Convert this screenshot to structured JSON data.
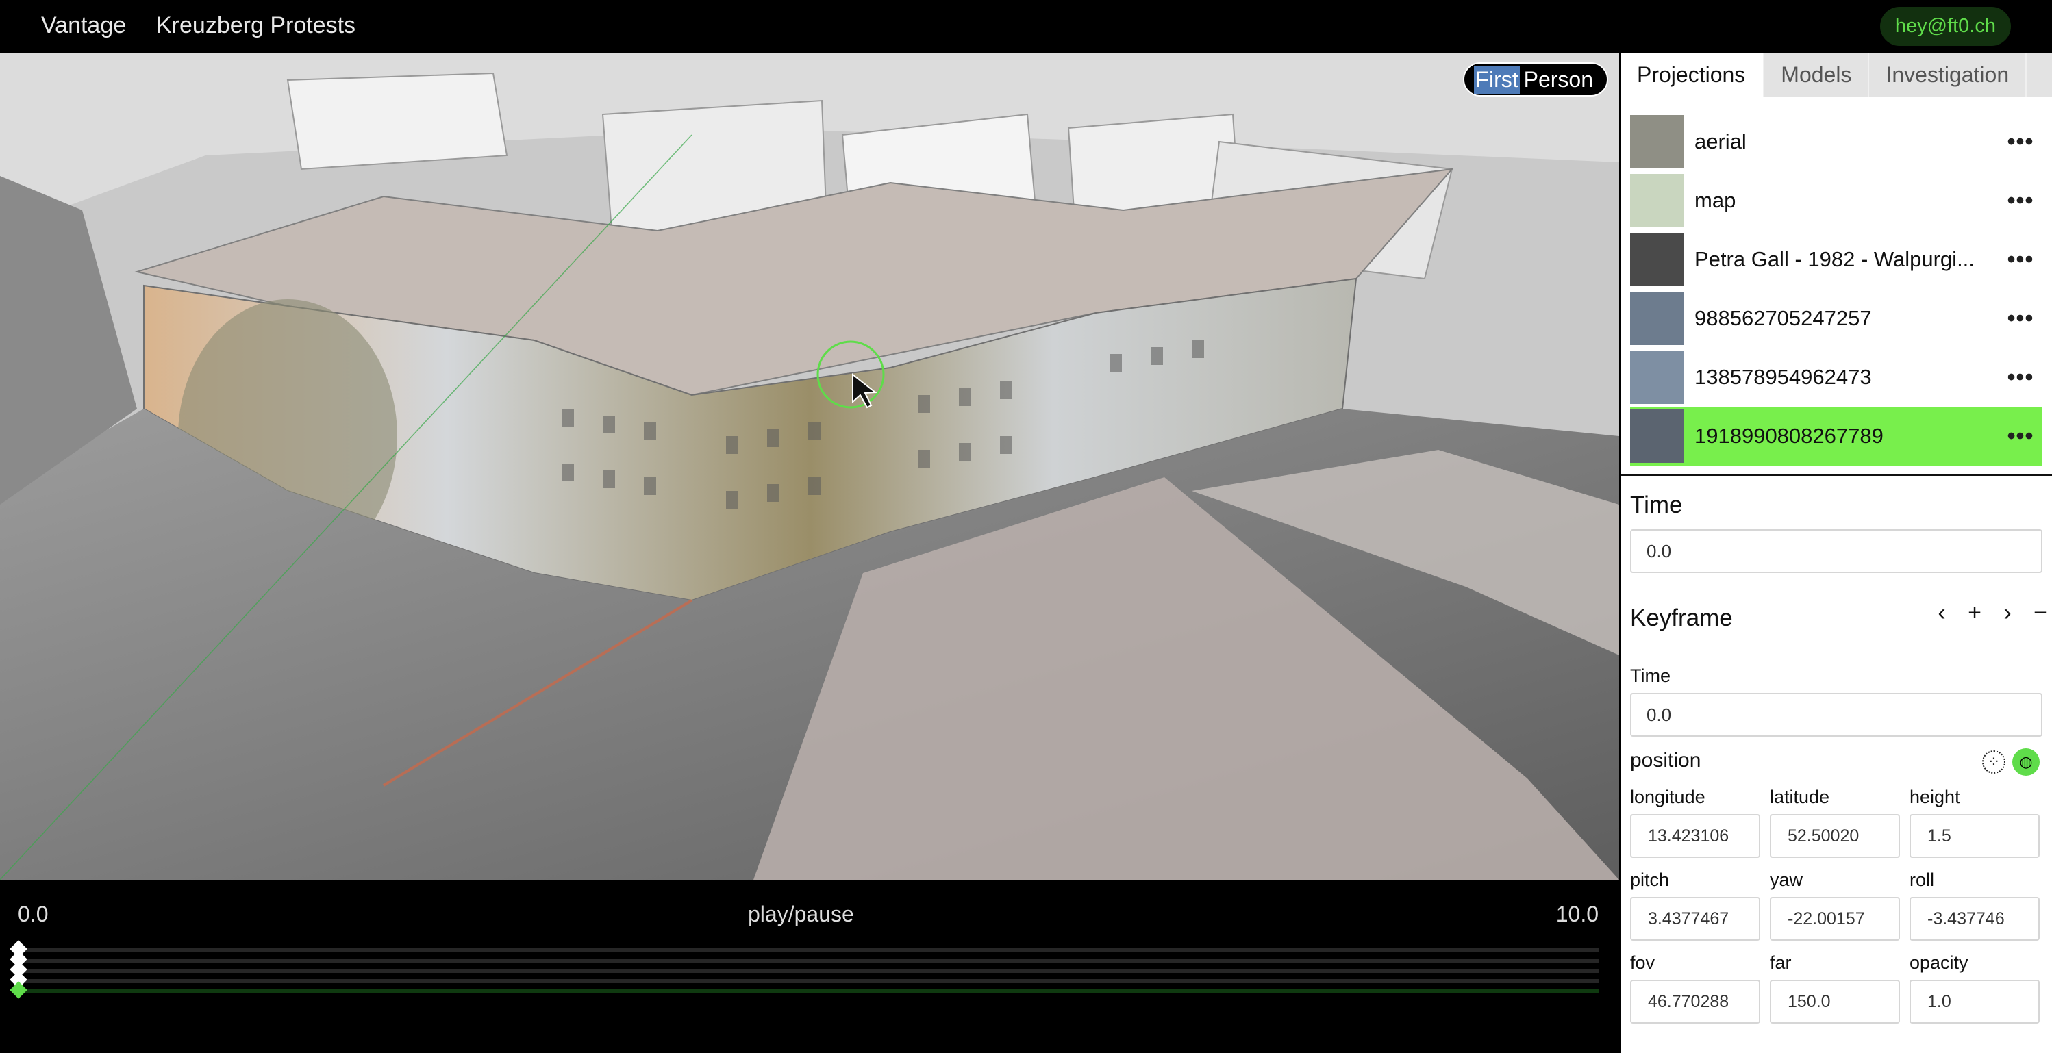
{
  "topbar": {
    "app_name": "Vantage",
    "project_name": "Kreuzberg Protests",
    "user": "hey@ft0.ch"
  },
  "viewport": {
    "mode_first": "First",
    "mode_person": "Person"
  },
  "timeline": {
    "start": "0.0",
    "play_label": "play/pause",
    "end": "10.0"
  },
  "tabs": [
    "Projections",
    "Models",
    "Investigation"
  ],
  "projections": [
    {
      "label": "aerial",
      "thumb_color": "#8f8f85"
    },
    {
      "label": "map",
      "thumb_color": "#c9d6bf"
    },
    {
      "label": "Petra Gall - 1982 - Walpurgi...",
      "thumb_color": "#4a4a4a"
    },
    {
      "label": "988562705247257",
      "thumb_color": "#6d7c8e"
    },
    {
      "label": "138578954962473",
      "thumb_color": "#7e8fa3"
    },
    {
      "label": "1918990808267789",
      "thumb_color": "#5b6470"
    }
  ],
  "more_label": "•••",
  "time_section": {
    "title": "Time",
    "value": "0.0"
  },
  "keyframe": {
    "title": "Keyframe",
    "controls": [
      "‹",
      "+",
      "›",
      "−"
    ],
    "time_label": "Time",
    "time_value": "0.0",
    "position_label": "position",
    "fields": {
      "longitude": {
        "label": "longitude",
        "value": "13.423106"
      },
      "latitude": {
        "label": "latitude",
        "value": "52.50020"
      },
      "height": {
        "label": "height",
        "value": "1.5"
      },
      "pitch": {
        "label": "pitch",
        "value": "3.4377467"
      },
      "yaw": {
        "label": "yaw",
        "value": "-22.00157"
      },
      "roll": {
        "label": "roll",
        "value": "-3.437746"
      },
      "fov": {
        "label": "fov",
        "value": "46.770288"
      },
      "far": {
        "label": "far",
        "value": "150.0"
      },
      "opacity": {
        "label": "opacity",
        "value": "1.0"
      }
    }
  },
  "colors": {
    "accent": "#78ef4c",
    "accent_dark": "#12300f",
    "toggle_blue": "#4e7bb8"
  }
}
